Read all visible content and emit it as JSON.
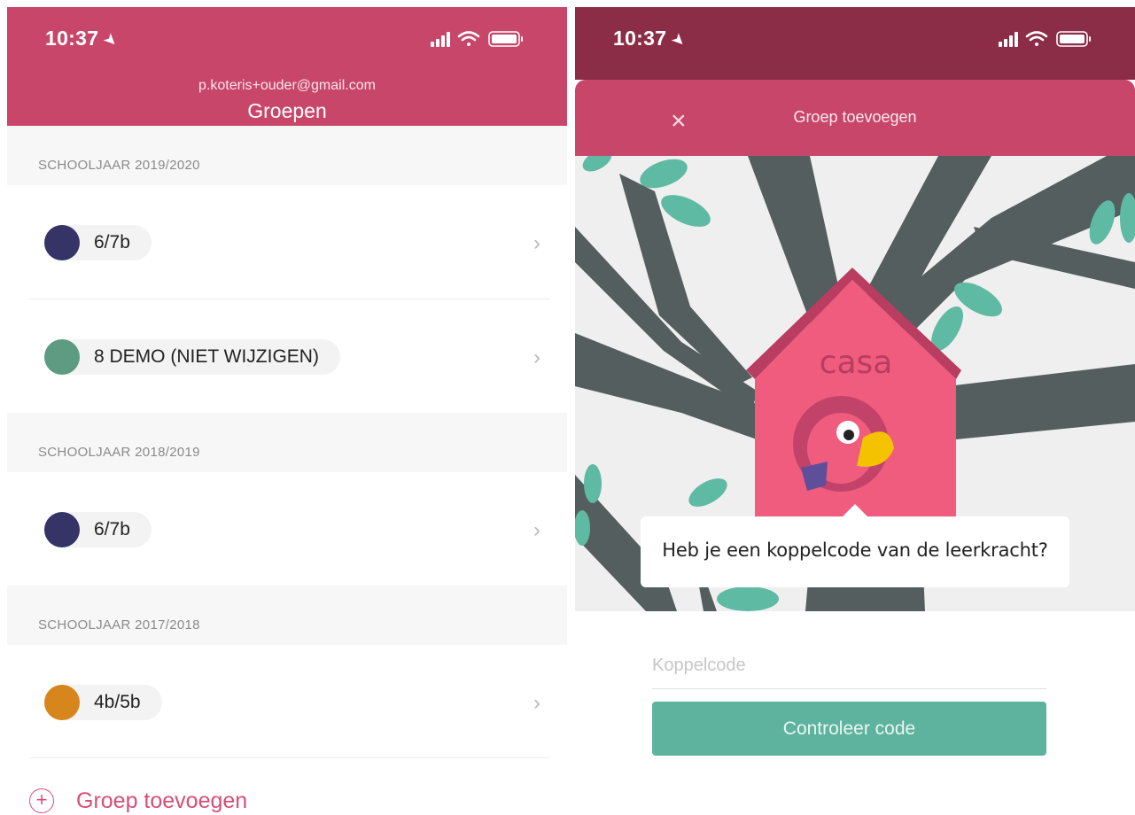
{
  "left": {
    "status": {
      "time": "10:37"
    },
    "header": {
      "email": "p.koteris+ouder@gmail.com",
      "title": "Groepen"
    },
    "sections": [
      {
        "title": "SCHOOLJAAR 2019/2020",
        "groups": [
          {
            "name": "6/7b",
            "color": "#363466"
          },
          {
            "name": "8 DEMO (NIET WIJZIGEN)",
            "color": "#5e9b83"
          }
        ]
      },
      {
        "title": "SCHOOLJAAR 2018/2019",
        "groups": [
          {
            "name": "6/7b",
            "color": "#363466"
          }
        ]
      },
      {
        "title": "SCHOOLJAAR 2017/2018",
        "groups": [
          {
            "name": "4b/5b",
            "color": "#d6861c"
          }
        ]
      }
    ],
    "chevron": "›",
    "add_group": {
      "icon": "+",
      "label": "Groep toevoegen"
    }
  },
  "right": {
    "status": {
      "time": "10:37"
    },
    "modal": {
      "close_icon": "×",
      "title": "Groep toevoegen"
    },
    "illustration": {
      "house_text": "casa",
      "speech": "Heb je een koppelcode van de leerkracht?"
    },
    "input": {
      "placeholder": "Koppelcode",
      "value": ""
    },
    "button": {
      "label": "Controleer code"
    }
  },
  "colors": {
    "header": "#c84669",
    "dim_header": "#8c2d47",
    "accent": "#d94d77",
    "button": "#5eb39e"
  }
}
